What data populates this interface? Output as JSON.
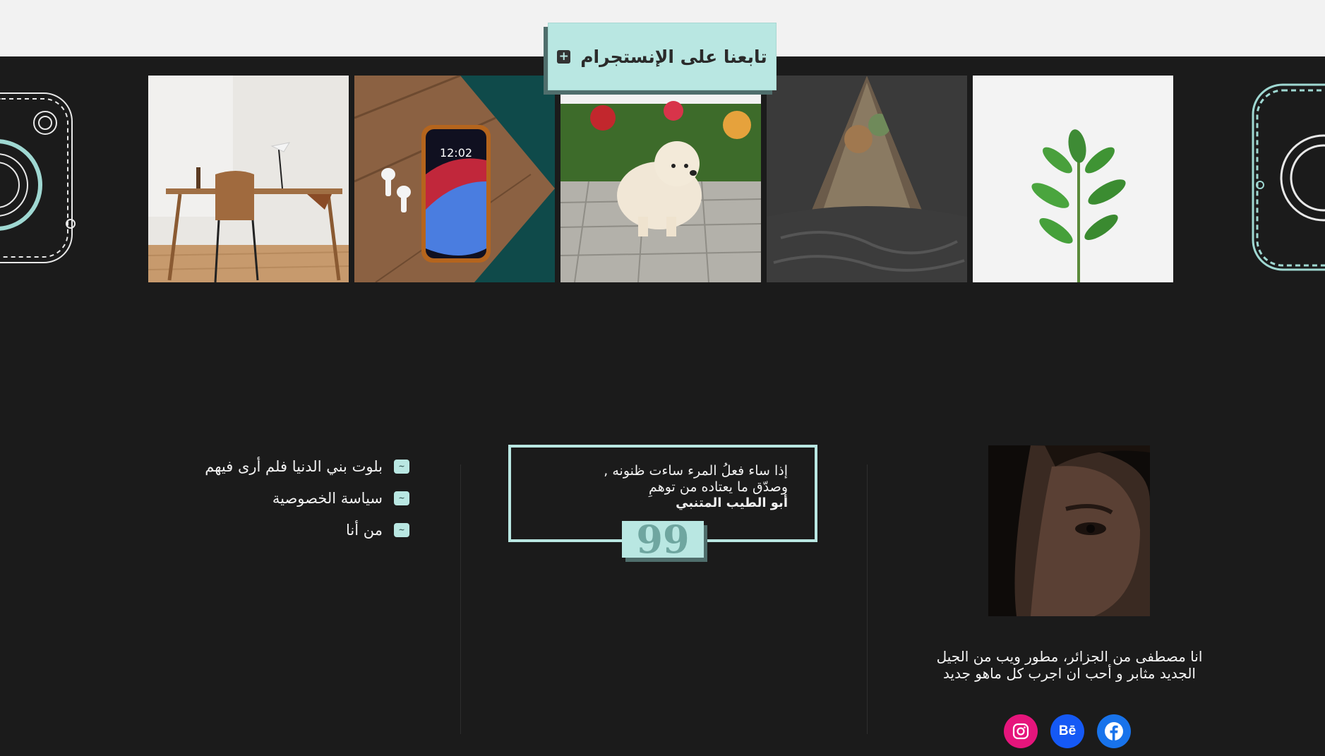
{
  "instagram": {
    "follow_label": "تابعنا على الإنستجرام",
    "plus_glyph": "+",
    "gallery": [
      {
        "subject": "wooden desk and chair"
      },
      {
        "subject": "phone with earbuds",
        "clock": "12:02"
      },
      {
        "subject": "pomeranian puppy"
      },
      {
        "subject": "tent with blanket"
      },
      {
        "subject": "green plant"
      }
    ]
  },
  "footer": {
    "links": [
      {
        "label": "بلوت بني الدنيا فلم أرى فيهم",
        "badge": "~"
      },
      {
        "label": "سياسة الخصوصية",
        "badge": "~"
      },
      {
        "label": "من أنا",
        "badge": "~"
      }
    ],
    "quote": {
      "line1": "إذا ساء فعلُ المرء ساءت ظنونه ,",
      "line2": "وصدّق ما يعتاده من توهمِ",
      "author": "أبو الطيب المتنبي",
      "mark": "99"
    },
    "about": {
      "line1": "انا مصطفى من الجزائر، مطور ويب من الجيل",
      "line2": "الجديد مثابر و أحب ان اجرب كل ماهو جديد"
    },
    "socials": {
      "behance_text": "Bē"
    }
  },
  "colors": {
    "accent": "#b9e7e2",
    "accent_shadow": "#4f6e6c",
    "background": "#1b1b1b",
    "instagram": "#e6157c",
    "behance": "#1559f5",
    "facebook": "#1873eb"
  }
}
